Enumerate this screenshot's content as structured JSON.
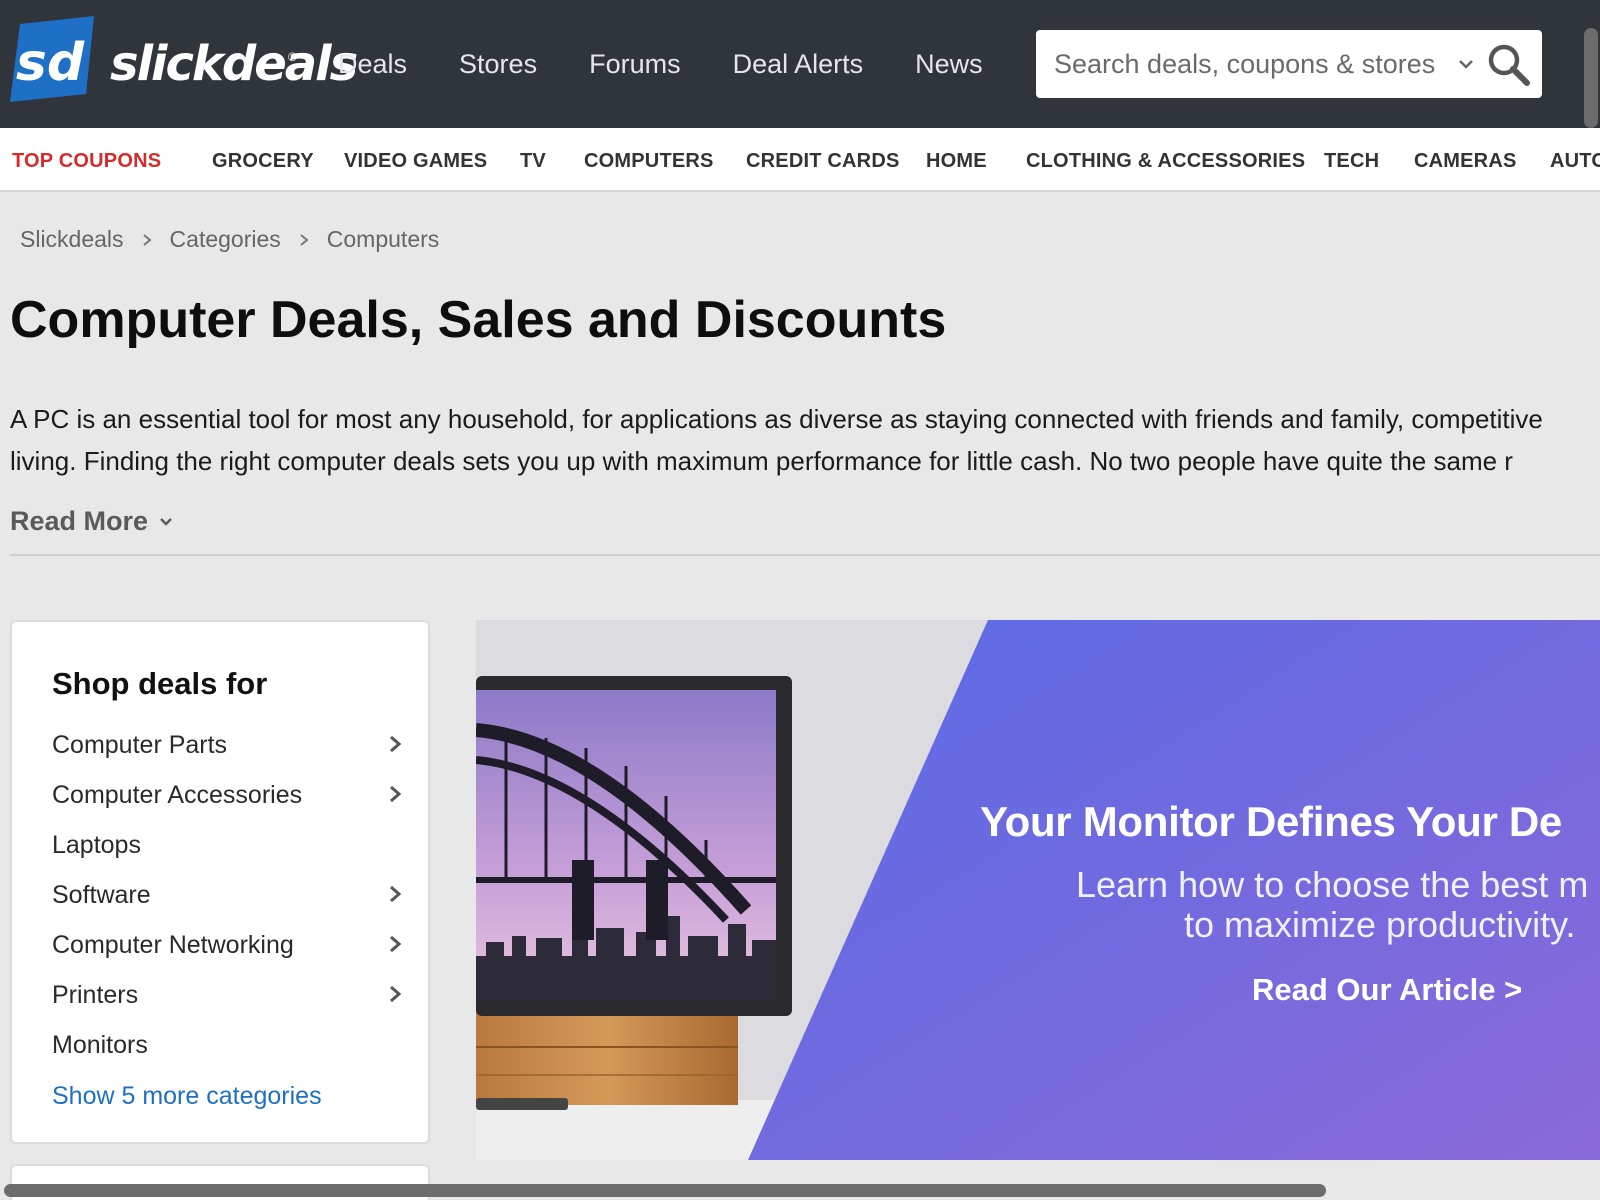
{
  "header": {
    "logo_mark": "sd",
    "logo_text": "slickdeals",
    "logo_reg": "®",
    "nav": [
      "Deals",
      "Stores",
      "Forums",
      "Deal Alerts",
      "News"
    ],
    "search_placeholder": "Search deals, coupons & stores",
    "bg_color": "#30353c",
    "logo_color": "#1e6fc6"
  },
  "categories": {
    "top_coupons": "TOP COUPONS",
    "items": [
      "GROCERY",
      "VIDEO GAMES",
      "TV",
      "COMPUTERS",
      "CREDIT CARDS",
      "HOME",
      "CLOTHING & ACCESSORIES",
      "TECH",
      "CAMERAS",
      "AUTO"
    ],
    "accent_color": "#d42b2b"
  },
  "breadcrumb": [
    "Slickdeals",
    "Categories",
    "Computers"
  ],
  "page": {
    "title": "Computer Deals, Sales and Discounts",
    "intro_line1": "A PC is an essential tool for most any household, for applications as diverse as staying connected with friends and family, competitive",
    "intro_line2": "living. Finding the right computer deals sets you up with maximum performance for little cash. No two people have quite the same r",
    "read_more": "Read More"
  },
  "sidebar": {
    "heading": "Shop deals for",
    "items": [
      {
        "label": "Computer Parts",
        "has_children": true
      },
      {
        "label": "Computer Accessories",
        "has_children": true
      },
      {
        "label": "Laptops",
        "has_children": false
      },
      {
        "label": "Software",
        "has_children": true
      },
      {
        "label": "Computer Networking",
        "has_children": true
      },
      {
        "label": "Printers",
        "has_children": true
      },
      {
        "label": "Monitors",
        "has_children": false
      }
    ],
    "show_more": "Show 5 more categories",
    "link_color": "#1e6fc6"
  },
  "banner": {
    "headline": "Your Monitor Defines Your De",
    "sub_line1": "Learn how to choose the best m",
    "sub_line2": "to maximize productivity.",
    "cta": "Read Our Article >",
    "gradient_colors": [
      "#5a6be6",
      "#8a6ad8"
    ]
  }
}
